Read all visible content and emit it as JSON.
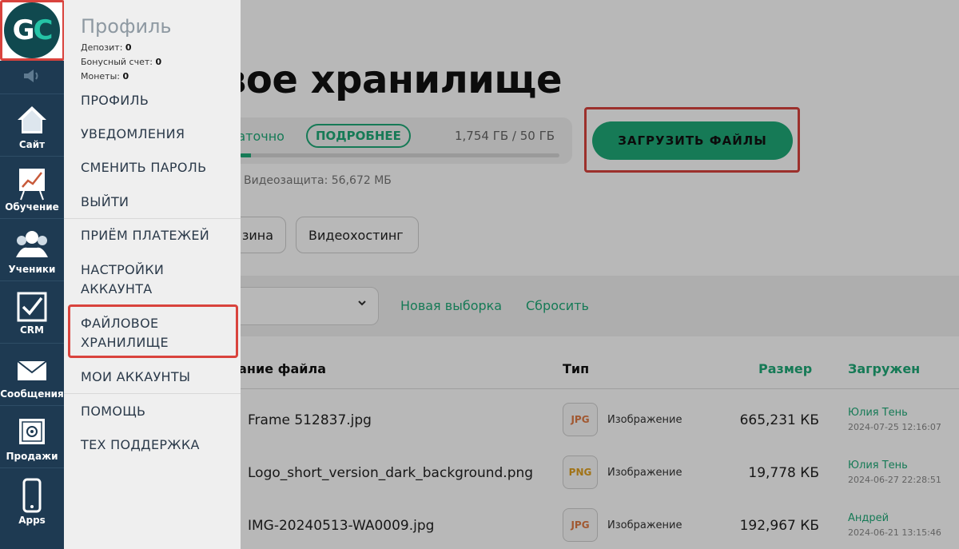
{
  "page": {
    "title": "вое хранилище",
    "storage_warning": "таточно",
    "details_label": "ПОДРОБНЕЕ",
    "storage_used": "1,754 ГБ / 50 ГБ",
    "storage_fraction": 0.035,
    "upload_label": "ЗАГРУЗИТЬ ФАЙЛЫ",
    "video_protection": "Видеозащита: 56,672 МБ",
    "tabs": [
      "зина",
      "Видеохостинг"
    ],
    "filter_new": "Новая выборка",
    "filter_reset": "Сбросить",
    "table": {
      "headers": {
        "name": "вание файла",
        "type": "Тип",
        "size": "Размер",
        "uploaded": "Загружен"
      },
      "rows": [
        {
          "name": "Frame 512837.jpg",
          "badge": "JPG",
          "badge_color": "#e07b45",
          "type": "Изображение",
          "size": "665,231 КБ",
          "user": "Юлия Тень",
          "date": "2024-07-25 12:16:07"
        },
        {
          "name": "Logo_short_version_dark_background.png",
          "badge": "PNG",
          "badge_color": "#e0a020",
          "type": "Изображение",
          "size": "19,778 КБ",
          "user": "Юлия Тень",
          "date": "2024-06-27 22:28:51"
        },
        {
          "name": "IMG-20240513-WA0009.jpg",
          "badge": "JPG",
          "badge_color": "#e07b45",
          "type": "Изображение",
          "size": "192,967 КБ",
          "user": "Андрей",
          "date": "2024-06-21 13:15:46"
        }
      ]
    }
  },
  "logo": {
    "letters_1": "G",
    "letters_2": "C"
  },
  "rail": [
    {
      "label": "Сайт",
      "icon": "home-icon"
    },
    {
      "label": "Обучение",
      "icon": "chart-board-icon"
    },
    {
      "label": "Ученики",
      "icon": "users-icon"
    },
    {
      "label": "CRM",
      "icon": "checkbox-icon"
    },
    {
      "label": "Сообщения",
      "icon": "envelope-icon"
    },
    {
      "label": "Продажи",
      "icon": "safe-icon"
    },
    {
      "label": "Apps",
      "icon": "phone-icon"
    }
  ],
  "panel": {
    "title": "Профиль",
    "deposit_label": "Депозит:",
    "deposit_value": "0",
    "bonus_label": "Бонусный счет:",
    "bonus_value": "0",
    "coins_label": "Монеты:",
    "coins_value": "0",
    "menu": [
      "ПРОФИЛЬ",
      "УВЕДОМЛЕНИЯ",
      "СМЕНИТЬ ПАРОЛЬ",
      "ВЫЙТИ",
      "ПРИЁМ ПЛАТЕЖЕЙ",
      "НАСТРОЙКИ АККАУНТА",
      "ФАЙЛОВОЕ ХРАНИЛИЩЕ",
      "МОИ АККАУНТЫ",
      "ПОМОЩЬ",
      "ТЕХ ПОДДЕРЖКА"
    ]
  },
  "colors": {
    "accent": "#1faa78",
    "rail": "#1e3a52",
    "highlight": "#d9433d",
    "logo_bg": "#10494f",
    "logo_c": "#25c3a6"
  }
}
